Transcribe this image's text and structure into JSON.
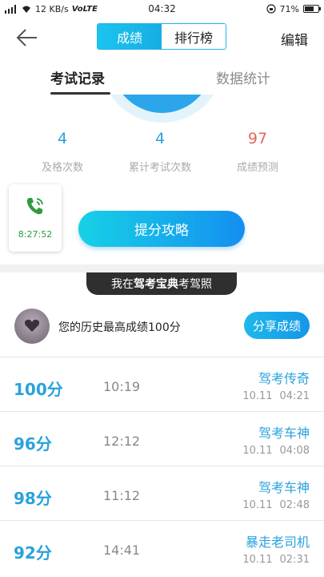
{
  "status_bar": {
    "network_speed": "12 KB/s",
    "volte": "VoLTE",
    "time": "04:32",
    "battery": "71%",
    "battery_level": 0.71
  },
  "header": {
    "tabs": [
      "成绩",
      "排行榜"
    ],
    "active_tab": 0,
    "edit_label": "编辑"
  },
  "subtabs": [
    "考试记录",
    "数据统计"
  ],
  "stats": [
    {
      "value": "4",
      "label": "及格次数"
    },
    {
      "value": "4",
      "label": "累计考试次数"
    },
    {
      "value": "97",
      "label": "成绩预测"
    }
  ],
  "timer": {
    "time": "8:27:52"
  },
  "tips_button": "提分攻略",
  "banner": {
    "prefix": "我在",
    "brand": "驾考宝典",
    "suffix": "考驾照"
  },
  "best": {
    "text": "您的历史最高成绩100分",
    "share_label": "分享成绩"
  },
  "records": [
    {
      "score": "100",
      "unit": "分",
      "duration": "10:19",
      "title": "驾考传奇",
      "date": "10.11",
      "time": "04:21"
    },
    {
      "score": "96",
      "unit": "分",
      "duration": "12:12",
      "title": "驾考车神",
      "date": "10.11",
      "time": "04:08"
    },
    {
      "score": "98",
      "unit": "分",
      "duration": "11:12",
      "title": "驾考车神",
      "date": "10.11",
      "time": "02:48"
    },
    {
      "score": "92",
      "unit": "分",
      "duration": "14:41",
      "title": "暴走老司机",
      "date": "10.11",
      "time": "02:31"
    }
  ],
  "colors": {
    "accent": "#1fb3e6",
    "score_blue": "#2aa2dc",
    "prediction_red": "#e2685c",
    "timer_green": "#2e9b3b"
  }
}
